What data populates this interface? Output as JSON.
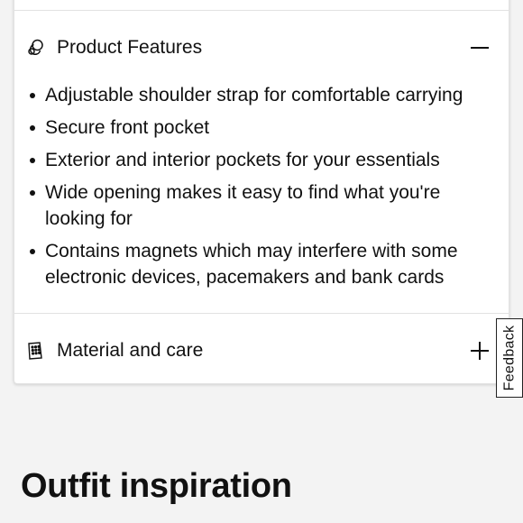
{
  "accordion": {
    "features": {
      "icon": "product-features-icon",
      "title": "Product Features",
      "expanded": true,
      "toggle_icon": "minus-icon",
      "items": [
        "Adjustable shoulder strap for comfortable carrying",
        "Secure front pocket",
        "Exterior and interior pockets for your essentials",
        "Wide opening makes it easy to find what you're looking for",
        "Contains magnets which may interfere with some electronic devices, pacemakers and bank cards"
      ]
    },
    "material": {
      "icon": "material-care-icon",
      "title": "Material and care",
      "expanded": false,
      "toggle_icon": "plus-icon"
    }
  },
  "feedback": {
    "label": "Feedback"
  },
  "outfit": {
    "heading": "Outfit inspiration"
  }
}
